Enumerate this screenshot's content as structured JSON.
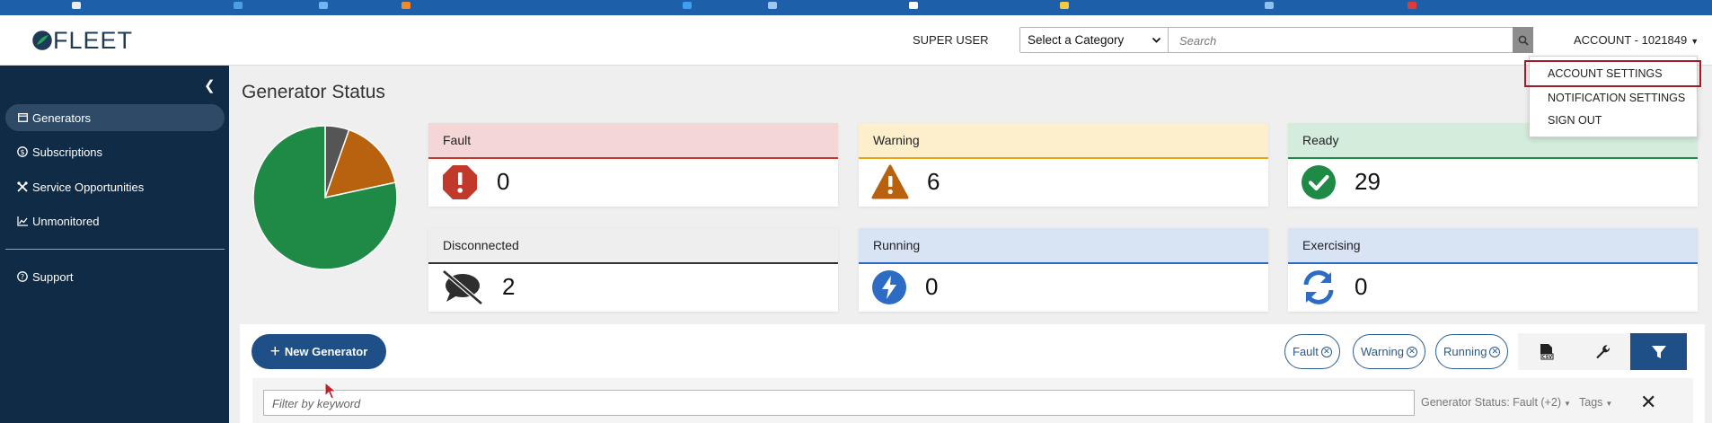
{
  "header": {
    "logo_text": "FLEET",
    "user_label": "SUPER USER",
    "category_select": "Select a Category",
    "search_placeholder": "Search",
    "account_label": "ACCOUNT - 1021849"
  },
  "account_menu": {
    "items": [
      "ACCOUNT SETTINGS",
      "NOTIFICATION SETTINGS",
      "SIGN OUT"
    ],
    "highlighted": "ACCOUNT SETTINGS",
    "highlight_color": "#a11c2a"
  },
  "sidebar": {
    "items": [
      {
        "label": "Generators",
        "icon": "list-window-icon",
        "active": true
      },
      {
        "label": "Subscriptions",
        "icon": "dollar-circle-icon",
        "active": false
      },
      {
        "label": "Service Opportunities",
        "icon": "tools-icon",
        "active": false
      },
      {
        "label": "Unmonitored",
        "icon": "chart-line-icon",
        "active": false
      },
      {
        "label": "Support",
        "icon": "question-circle-icon",
        "active": false
      }
    ]
  },
  "page": {
    "title": "Generator Status"
  },
  "status_cards": [
    {
      "label": "Fault",
      "count": "0",
      "color": "#c0392b",
      "head_bg": "#f5d6d6",
      "icon": "exclamation-octagon-icon"
    },
    {
      "label": "Warning",
      "count": "6",
      "color": "#b8620f",
      "head_bg": "#fdefcc",
      "icon": "warning-triangle-icon"
    },
    {
      "label": "Ready",
      "count": "29",
      "color": "#1e8a45",
      "head_bg": "#d3ecdb",
      "icon": "check-circle-icon"
    },
    {
      "label": "Disconnected",
      "count": "2",
      "color": "#333333",
      "head_bg": "#eeeeee",
      "icon": "comment-slash-icon"
    },
    {
      "label": "Running",
      "count": "0",
      "color": "#2c6cc4",
      "head_bg": "#d8e3f4",
      "icon": "bolt-circle-icon"
    },
    {
      "label": "Exercising",
      "count": "0",
      "color": "#2c6cc4",
      "head_bg": "#d8e3f4",
      "icon": "sync-icon"
    }
  ],
  "chart_data": {
    "type": "pie",
    "categories": [
      "Ready",
      "Warning",
      "Disconnected",
      "Fault",
      "Running",
      "Exercising"
    ],
    "values": [
      29,
      6,
      2,
      0,
      0,
      0
    ],
    "colors": [
      "#1e8a45",
      "#b8620f",
      "#555555",
      "#c0392b",
      "#2c6cc4",
      "#2c6cc4"
    ],
    "title": ""
  },
  "toolbar": {
    "new_button": "New Generator",
    "chips": [
      "Fault",
      "Warning",
      "Running"
    ],
    "csv_icon": "csv-file-icon",
    "wrench_icon": "wrench-icon",
    "filter_icon": "filter-icon"
  },
  "filter_bar": {
    "keyword_placeholder": "Filter by keyword",
    "status_filter": "Generator Status: Fault (+2)",
    "tags_filter": "Tags"
  }
}
